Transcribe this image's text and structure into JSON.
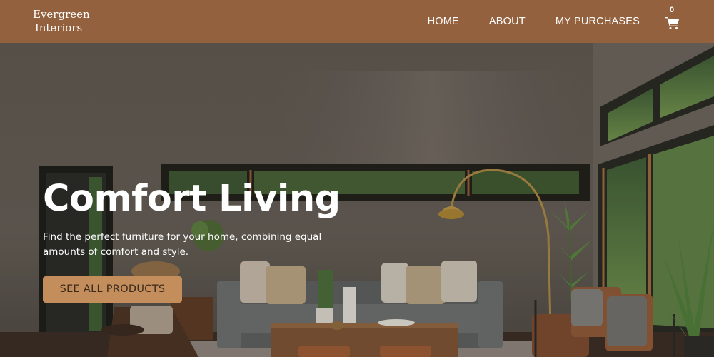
{
  "header": {
    "brand_line1": "Evergreen",
    "brand_line2": "Interiors",
    "nav": [
      {
        "label": "HOME"
      },
      {
        "label": "ABOUT"
      },
      {
        "label": "MY PURCHASES"
      }
    ],
    "cart_count": "0"
  },
  "hero": {
    "title": "Comfort Living",
    "subtitle": "Find the perfect furniture for your home, combining equal amounts of comfort and style.",
    "cta_label": "SEE ALL PRODUCTS"
  },
  "colors": {
    "header_bg": "#93613d",
    "cta_bg": "#c48e5c"
  },
  "icons": {
    "cart": "shopping-cart-icon"
  }
}
